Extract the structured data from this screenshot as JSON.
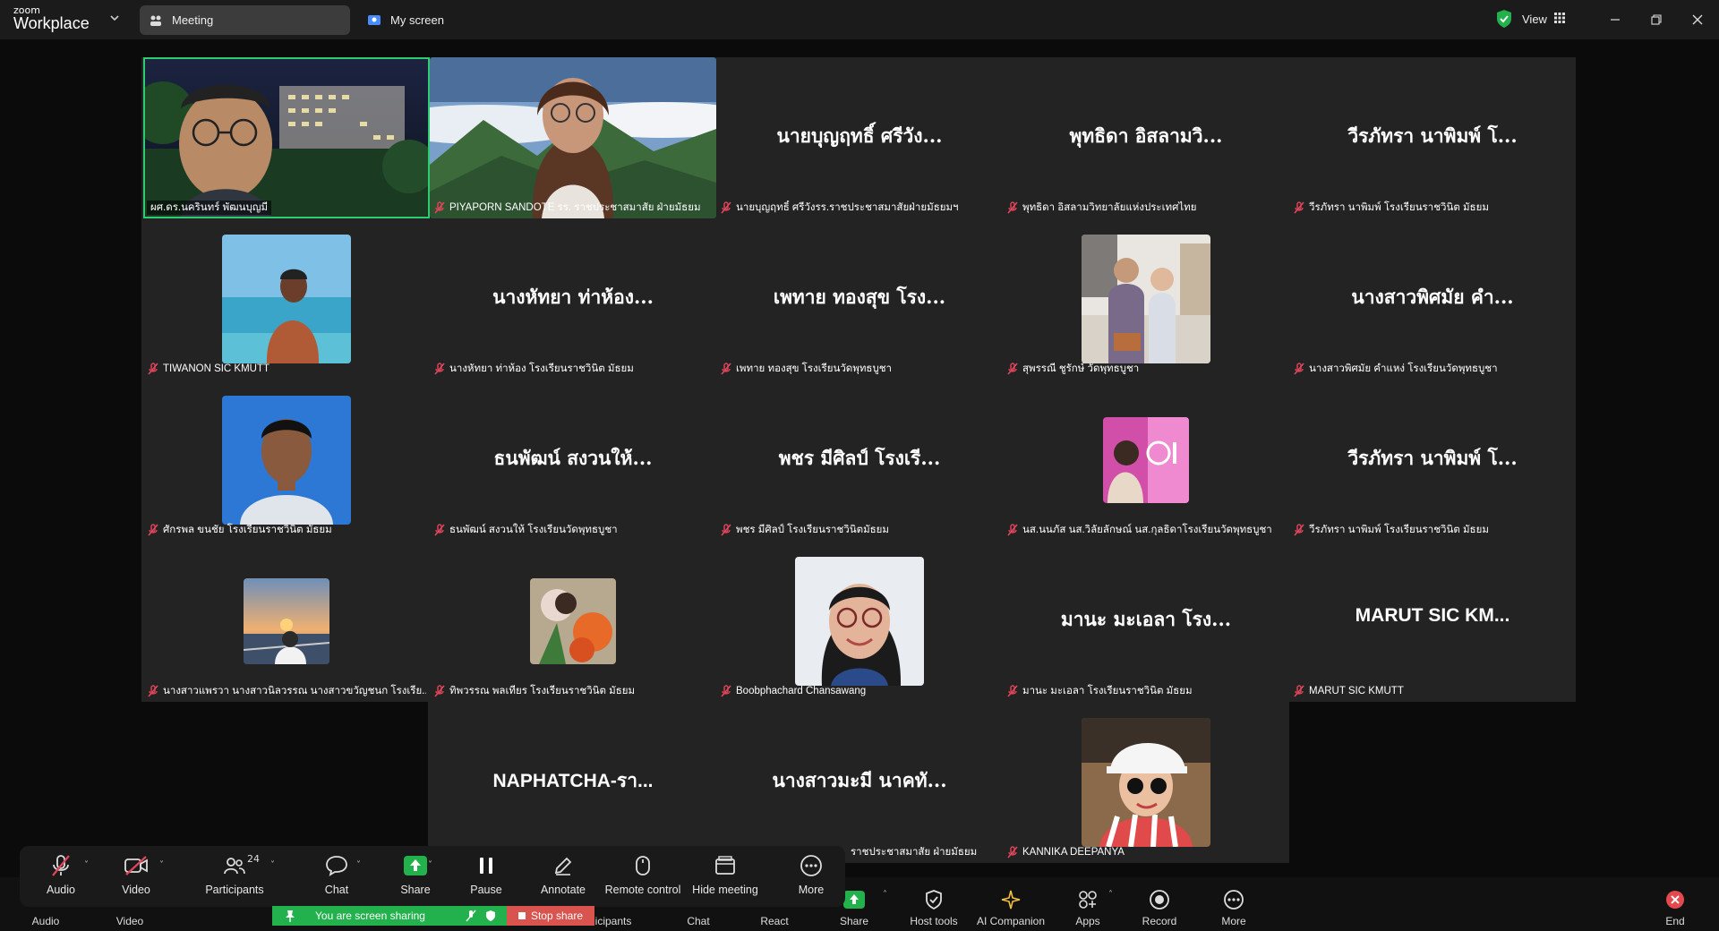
{
  "app": {
    "logo_top": "zoom",
    "logo_bottom": "Workplace"
  },
  "tabs": [
    {
      "label": "Meeting"
    },
    {
      "label": "My screen"
    }
  ],
  "titlebar": {
    "view_label": "View"
  },
  "participants": [
    {
      "label": "ผศ.ดร.นครินทร์ พัฒนบุญมี",
      "big": "",
      "photo": "man-glasses-building",
      "muted": false
    },
    {
      "label": "PIYAPORN SANDOTE รร. ราชประชาสมาสัย ฝ่ายมัธยม",
      "big": "",
      "photo": "woman-glasses-mountains",
      "muted": true
    },
    {
      "label": "นายบุญฤทธิ์ ศรีวังรร.ราชประชาสมาสัยฝ่ายมัธยมฯ",
      "big": "นายบุญฤทธิ์ ศรีวัง...",
      "muted": true
    },
    {
      "label": "พุทธิดา อิสลามวิทยาลัยแห่งประเทศไทย",
      "big": "พุทธิดา อิสลามวิ...",
      "muted": true
    },
    {
      "label": "วีรภัทรา นาพิมพ์ โรงเรียนราชวินิต มัธยม",
      "big": "วีรภัทรา นาพิมพ์ โ...",
      "muted": true
    },
    {
      "label": "TIWANON SIC KMUTT",
      "big": "",
      "photo": "man-sea",
      "muted": true
    },
    {
      "label": "นางหัทยา ท่าห้อง โรงเรียนราชวินิต มัธยม",
      "big": "นางหัทยา ท่าห้อง...",
      "muted": true
    },
    {
      "label": "เพทาย ทองสุข โรงเรียนวัดพุทธบูชา",
      "big": "เพทาย ทองสุข โรง...",
      "muted": true
    },
    {
      "label": "สุพรรณี ชูรักษ์ วัดพุทธบูชา",
      "big": "",
      "photo": "two-people-room",
      "muted": true
    },
    {
      "label": "นางสาวพิศมัย คำแหง่ โรงเรียนวัดพุทธบูชา",
      "big": "นางสาวพิศมัย คำ...",
      "muted": true
    },
    {
      "label": "ศักรพล ขนชัย โรงเรียนราชวินิต มัธยม",
      "big": "",
      "photo": "man-portrait-blue",
      "muted": true
    },
    {
      "label": "ธนพัฒน์ สงวนให้ โรงเรียนวัดพุทธบูชา",
      "big": "ธนพัฒน์ สงวนให้...",
      "muted": true
    },
    {
      "label": "พชร มีศิลป์ โรงเรียนราชวินิตมัธยม",
      "big": "พชร มีศิลป์ โรงเรี...",
      "muted": true
    },
    {
      "label": "นส.นนภัส นส.วิลัยลักษณ์ นส.กุลธิดาโรงเรียนวัดพุทธบูชา",
      "big": "",
      "photo": "neon-pink",
      "muted": true
    },
    {
      "label": "วีรภัทรา นาพิมพ์ โรงเรียนราชวินิต มัธยม",
      "big": "วีรภัทรา นาพิมพ์ โ...",
      "muted": true
    },
    {
      "label": "นางสาวแพรวา นางสาวนิลวรรณ นางสาวขวัญชนก โรงเรีย...",
      "big": "",
      "photo": "sunset-rail",
      "muted": true
    },
    {
      "label": "ทิพวรรณ พลเทียร โรงเรียนราชวินิต มัธยม",
      "big": "",
      "photo": "flowers",
      "muted": true
    },
    {
      "label": "Boobphachard Chansawang",
      "big": "",
      "photo": "woman-glasses-smile",
      "muted": true
    },
    {
      "label": "มานะ มะเอลา โรงเรียนราชวินิต มัธยม",
      "big": "มานะ มะเอลา โรง...",
      "muted": true
    },
    {
      "label": "MARUT SIC KMUTT",
      "big": "MARUT SIC KM...",
      "muted": true,
      "latin": true
    },
    {
      "label": "",
      "big": "NAPHATCHA-รา...",
      "muted": true,
      "latin": true
    },
    {
      "label": "ราชประชาสมาสัย ฝ่ายมัธยม",
      "big": "นางสาวมะมี นาคทั...",
      "muted": true
    },
    {
      "label": "KANNIKA DEEPANYA",
      "big": "",
      "photo": "woman-cap",
      "muted": true
    }
  ],
  "share_toolbar": {
    "items": [
      {
        "label": "Audio",
        "icon": "mic-off-icon"
      },
      {
        "label": "Video",
        "icon": "video-off-icon"
      },
      {
        "label": "Participants",
        "icon": "participants-icon",
        "count": "24"
      },
      {
        "label": "Chat",
        "icon": "chat-icon"
      },
      {
        "label": "Share",
        "icon": "share-icon"
      },
      {
        "label": "Pause",
        "icon": "pause-icon"
      },
      {
        "label": "Annotate",
        "icon": "pencil-icon"
      },
      {
        "label": "Remote control",
        "icon": "mouse-icon"
      },
      {
        "label": "Hide meeting",
        "icon": "window-icon"
      },
      {
        "label": "More",
        "icon": "more-icon"
      }
    ],
    "sharing_status": "You are screen sharing",
    "stop_share": "Stop share"
  },
  "bottom_toolbar": {
    "items": [
      {
        "label": "Audio"
      },
      {
        "label": "Video"
      },
      {
        "label": "icipants"
      },
      {
        "label": "Chat"
      },
      {
        "label": "React"
      },
      {
        "label": "Share"
      },
      {
        "label": "Host tools"
      },
      {
        "label": "AI Companion"
      },
      {
        "label": "Apps"
      },
      {
        "label": "Record"
      },
      {
        "label": "More"
      },
      {
        "label": "End"
      }
    ]
  },
  "colors": {
    "active_speaker": "#2ecc71",
    "share_green": "#22b14c",
    "stop_red": "#d9534f",
    "end_red": "#e5484d",
    "mute_red": "#e0455a"
  }
}
